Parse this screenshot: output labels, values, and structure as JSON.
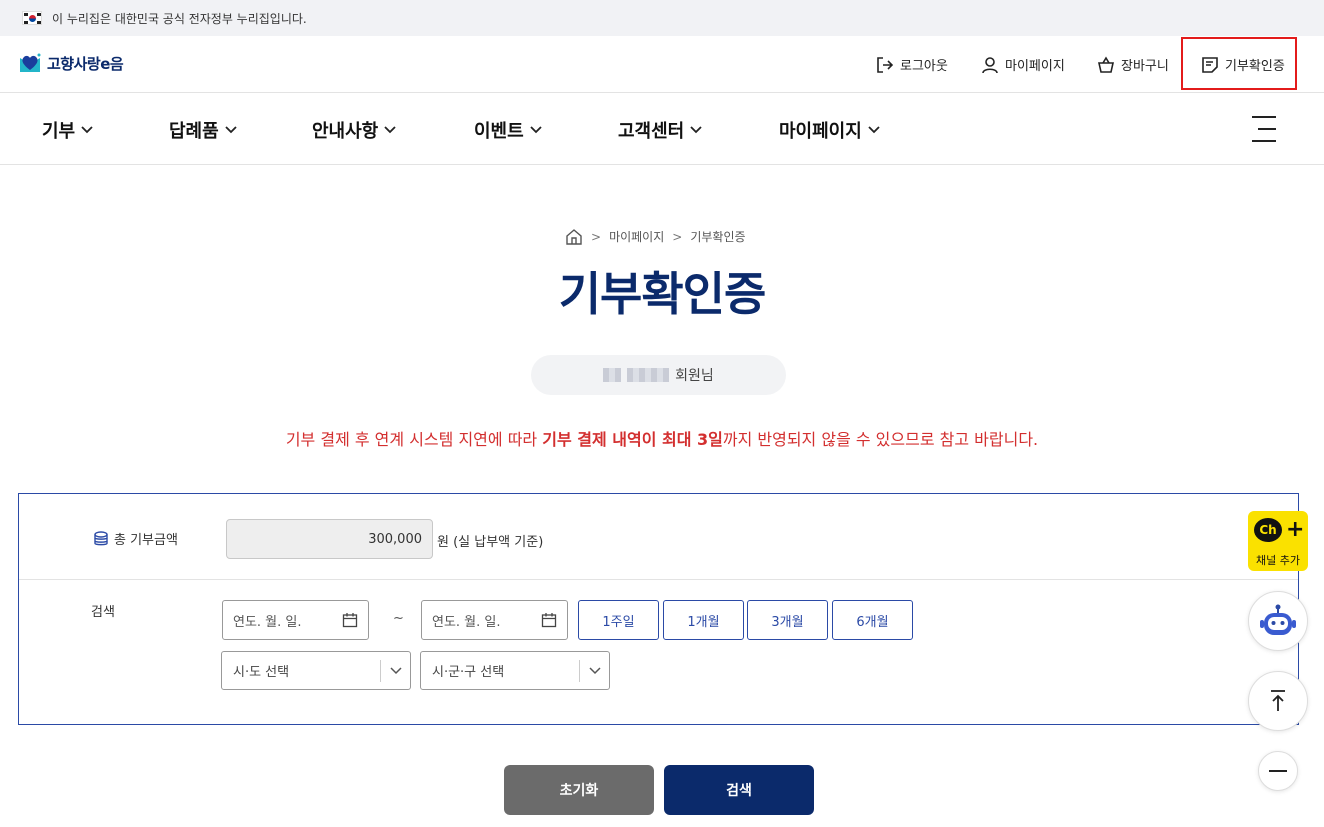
{
  "gov_banner": {
    "text": "이 누리집은 대한민국 공식 전자정부 누리집입니다."
  },
  "logo": {
    "text": "고향사랑e음"
  },
  "util_menu": [
    {
      "label": "로그아웃",
      "icon": "logout-icon"
    },
    {
      "label": "마이페이지",
      "icon": "user-icon"
    },
    {
      "label": "장바구니",
      "icon": "basket-icon"
    },
    {
      "label": "기부확인증",
      "icon": "certificate-icon",
      "highlighted": true
    }
  ],
  "gnb": [
    {
      "label": "기부"
    },
    {
      "label": "답례품"
    },
    {
      "label": "안내사항"
    },
    {
      "label": "이벤트"
    },
    {
      "label": "고객센터"
    },
    {
      "label": "마이페이지"
    }
  ],
  "breadcrumb": {
    "home_icon": "home-icon",
    "items": [
      "마이페이지",
      "기부확인증"
    ]
  },
  "page_title": "기부확인증",
  "member": {
    "suffix": "회원님"
  },
  "notice": {
    "before": "기부 결제 후 연계 시스템 지연에 따라 ",
    "emphasis": "기부 결제 내역이 최대 3일",
    "after": "까지 반영되지 않을 수 있으므로 참고 바랍니다."
  },
  "search_form": {
    "total_label": "총 기부금액",
    "total_value": "300,000",
    "total_unit": "원  (실 납부액 기준)",
    "search_label": "검색",
    "start_date_placeholder": "연도. 월. 일.",
    "end_date_placeholder": "연도. 월. 일.",
    "tilde": "~",
    "period_buttons": [
      "1주일",
      "1개월",
      "3개월",
      "6개월"
    ],
    "sido_select": "시·도 선택",
    "sigungu_select": "시·군·구 선택"
  },
  "buttons": {
    "reset": "초기화",
    "search": "검색"
  },
  "floating": {
    "kakao_ch": "Ch",
    "kakao_label": "채널 추가"
  },
  "colors": {
    "brand_navy": "#0b2a6b",
    "accent_blue": "#2b4aa6",
    "notice_red": "#d32f2f",
    "kakao_yellow": "#fae100",
    "highlight_red": "#e31b1b"
  }
}
